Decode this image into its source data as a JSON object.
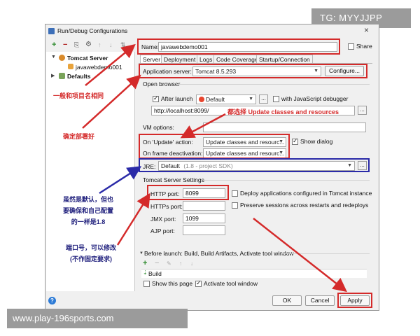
{
  "watermark_top": "TG: MYYJJPP",
  "watermark_bottom": "www.play-196sports.com",
  "window": {
    "title": "Run/Debug Configurations",
    "close": "×"
  },
  "toolbar": {
    "add": "+",
    "remove": "−",
    "copy": "⎘",
    "settings": "⚙",
    "up": "↑",
    "down": "↓",
    "sort": "⇅"
  },
  "tree": {
    "tomcat_server": "Tomcat Server",
    "config_item": "javawebdemo001",
    "defaults": "Defaults"
  },
  "name": {
    "label": "Name:",
    "value": "javawebdemo001",
    "share_label": "Share"
  },
  "tabs": [
    "Server",
    "Deployment",
    "Logs",
    "Code Coverage",
    "Startup/Connection"
  ],
  "server": {
    "app_server_label": "Application server:",
    "app_server_value": "Tomcat 8.5.293",
    "configure_button": "Configure...",
    "open_browser_section": "Open browser",
    "after_launch_label": "After launch",
    "browser_value": "Default",
    "browse_button": "...",
    "js_debugger_label": "with JavaScript debugger",
    "url_value": "http://localhost:8099/",
    "vm_options_label": "VM options:",
    "on_update_label": "On 'Update' action:",
    "on_update_value": "Update classes and resourc...",
    "show_dialog_label": "Show dialog",
    "on_frame_label": "On frame deactivation:",
    "on_frame_value": "Update classes and resourc...",
    "jre_label": "JRE:",
    "jre_value": "Default",
    "jre_hint": "(1.8 - project SDK)",
    "tomcat_settings_section": "Tomcat Server Settings",
    "http_port_label": "HTTP port:",
    "http_port_value": "8099",
    "https_port_label": "HTTPs port:",
    "https_port_value": "",
    "jmx_port_label": "JMX port:",
    "jmx_port_value": "1099",
    "ajp_port_label": "AJP port:",
    "ajp_port_value": "",
    "deploy_label": "Deploy applications configured in Tomcat instance",
    "preserve_label": "Preserve sessions across restarts and redeploys"
  },
  "before_launch": {
    "title": "Before launch: Build, Build Artifacts, Activate tool window",
    "item": "Build",
    "show_page_label": "Show this page",
    "activate_label": "Activate tool window"
  },
  "buttons": {
    "ok": "OK",
    "cancel": "Cancel",
    "apply": "Apply",
    "help": "?"
  },
  "annotations": {
    "same_as_project": "一般和项目名相同",
    "confirm_deploy": "确定部署好",
    "select_update": "都选择 Update classes and resources",
    "jre_note_1": "虽然是默认，但也",
    "jre_note_2": "要确保和自己配置",
    "jre_note_3": "的一样是1.8",
    "port_note_1": "端口号，可以修改",
    "port_note_2": "(不作固定要求)"
  },
  "colors": {
    "annotation_red": "#d42a2a",
    "annotation_blue": "#2a2aa8",
    "window_bg": "#f0f0f0"
  }
}
